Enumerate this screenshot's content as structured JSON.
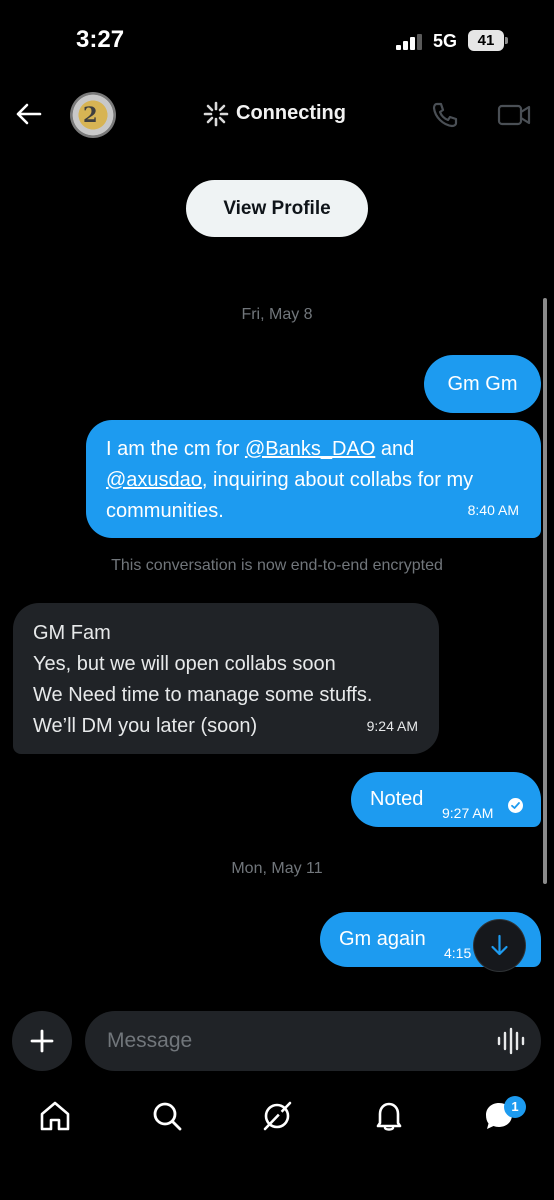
{
  "status_bar": {
    "time": "3:27",
    "network": "5G",
    "battery": "41"
  },
  "header": {
    "title": "Connecting",
    "avatar_text": "2"
  },
  "view_profile_label": "View Profile",
  "date_separators": [
    "Fri, May 8",
    "Mon, May 11"
  ],
  "messages": {
    "m1": {
      "text": "Gm Gm"
    },
    "m2": {
      "line1_pre": "I am the cm for ",
      "mention1": "@Banks_DAO",
      "line1_post": " and",
      "mention2": "@axusdao",
      "line2_post": ", inquiring about collabs for my",
      "line3": "communities.",
      "time": "8:40 AM"
    },
    "m3": {
      "lines": [
        "GM Fam",
        "Yes, but we will open collabs soon",
        "We Need time to manage some stuffs.",
        "We’ll DM you later (soon)"
      ],
      "time": "9:24 AM"
    },
    "m4": {
      "text": "Noted",
      "time": "9:27 AM"
    },
    "m5": {
      "text": "Gm again",
      "time": "4:15"
    }
  },
  "encryption_notice": "This conversation is now end-to-end encrypted",
  "composer": {
    "placeholder": "Message"
  },
  "bottom_nav": {
    "messages_badge": "1",
    "icons": [
      "home-icon",
      "search-icon",
      "grok-icon",
      "notifications-icon",
      "messages-icon"
    ]
  },
  "colors": {
    "accent": "#1d9bf0",
    "incoming_bubble": "#202327",
    "background": "#000000"
  }
}
